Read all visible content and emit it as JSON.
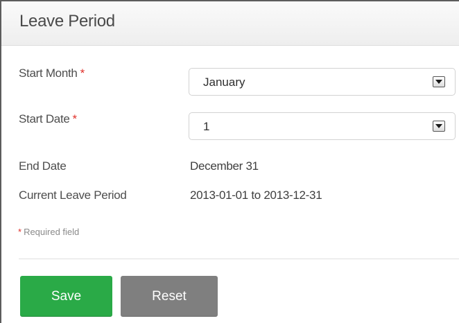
{
  "panel": {
    "title": "Leave Period"
  },
  "form": {
    "required_marker": "*",
    "start_month": {
      "label": "Start Month",
      "selected": "January"
    },
    "start_date": {
      "label": "Start Date",
      "selected": "1"
    },
    "end_date": {
      "label": "End Date",
      "value": "December 31"
    },
    "current_leave_period": {
      "label": "Current Leave Period",
      "value": "2013-01-01 to 2013-12-31"
    },
    "required_note": "Required field"
  },
  "actions": {
    "save_label": "Save",
    "reset_label": "Reset"
  },
  "icons": {
    "dropdown": "chevron-down-icon"
  },
  "colors": {
    "save_button": "#2aaa47",
    "reset_button": "#7f7f7f",
    "required_star": "#e0302a"
  }
}
